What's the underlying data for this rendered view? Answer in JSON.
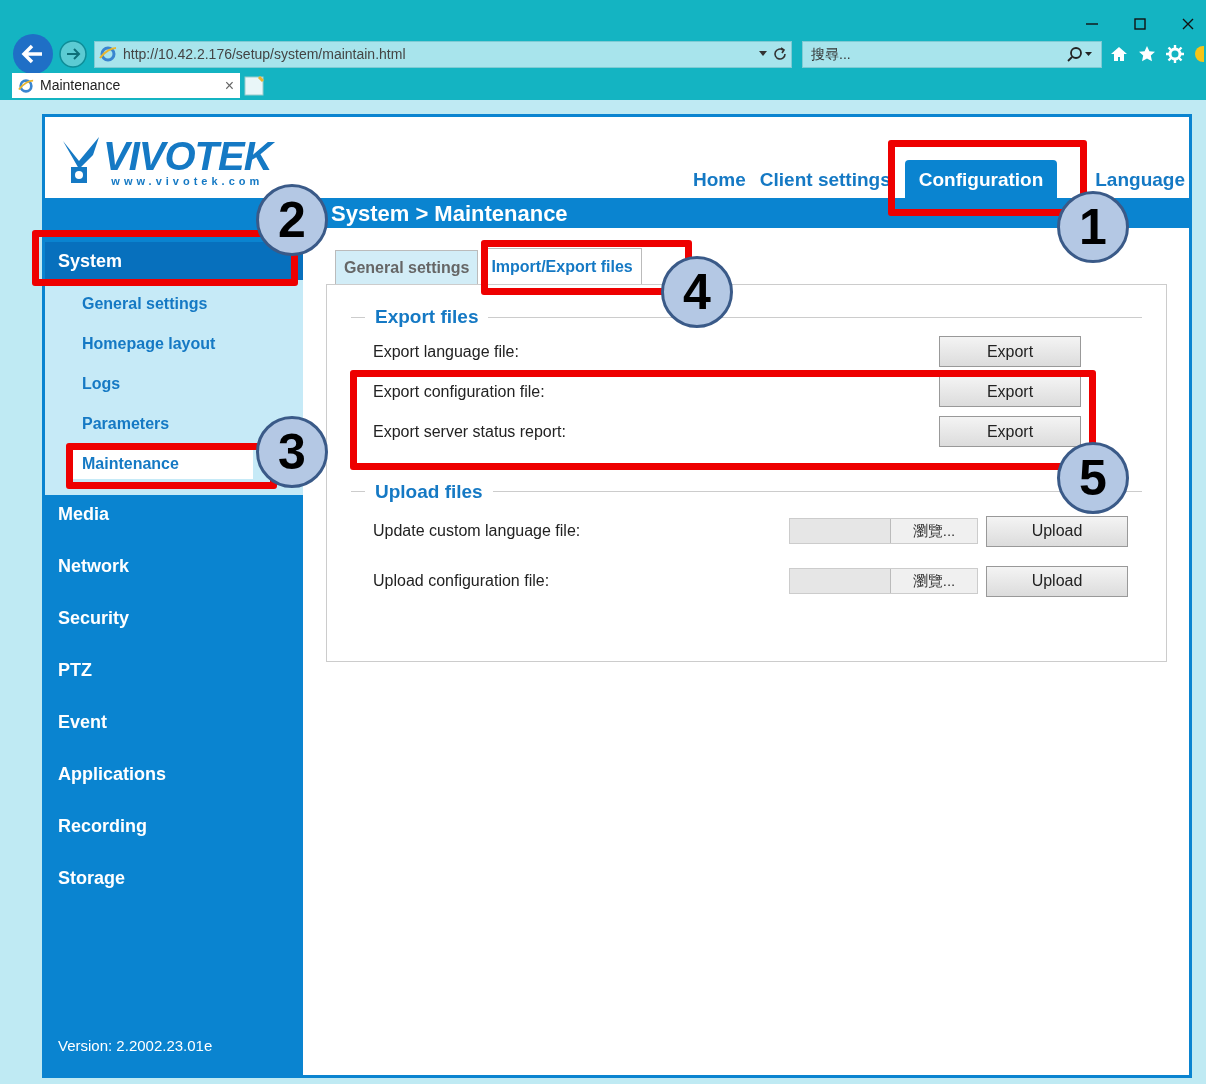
{
  "browser": {
    "url": "http://10.42.2.176/setup/system/maintain.html",
    "search_placeholder": "搜尋...",
    "tab": {
      "title": "Maintenance",
      "close": "×"
    }
  },
  "logo": {
    "name": "VIVOTEK",
    "site": "www.vivotek.com"
  },
  "nav": [
    {
      "label": "Home",
      "selected": false
    },
    {
      "label": "Client settings",
      "selected": false
    },
    {
      "label": "Configuration",
      "selected": true
    },
    {
      "label": "Language",
      "selected": false
    }
  ],
  "breadcrumb": "System > Maintenance",
  "sidebar": [
    {
      "label": "System",
      "selected": true,
      "children": [
        {
          "label": "General settings",
          "selected": false
        },
        {
          "label": "Homepage layout",
          "selected": false
        },
        {
          "label": "Logs",
          "selected": false
        },
        {
          "label": "Parameters",
          "selected": false
        },
        {
          "label": "Maintenance",
          "selected": true
        }
      ]
    },
    {
      "label": "Media",
      "selected": false
    },
    {
      "label": "Network",
      "selected": false
    },
    {
      "label": "Security",
      "selected": false
    },
    {
      "label": "PTZ",
      "selected": false
    },
    {
      "label": "Event",
      "selected": false
    },
    {
      "label": "Applications",
      "selected": false
    },
    {
      "label": "Recording",
      "selected": false
    },
    {
      "label": "Storage",
      "selected": false
    }
  ],
  "version": "Version: 2.2002.23.01e",
  "tabs": [
    {
      "label": "General settings",
      "selected": false
    },
    {
      "label": "Import/Export files",
      "selected": true
    }
  ],
  "sections": [
    {
      "title": "Export files",
      "rows": [
        {
          "kind": "export",
          "label": "Export language file:",
          "button": "Export"
        },
        {
          "kind": "export",
          "label": "Export configuration file:",
          "button": "Export"
        },
        {
          "kind": "export",
          "label": "Export server status report:",
          "button": "Export"
        }
      ]
    },
    {
      "title": "Upload files",
      "rows": [
        {
          "kind": "upload",
          "label": "Update custom language file:",
          "browse": "瀏覽...",
          "button": "Upload"
        },
        {
          "kind": "upload",
          "label": "Upload configuration file:",
          "browse": "瀏覽...",
          "button": "Upload"
        }
      ]
    }
  ],
  "callouts": [
    "1",
    "2",
    "3",
    "4",
    "5"
  ]
}
